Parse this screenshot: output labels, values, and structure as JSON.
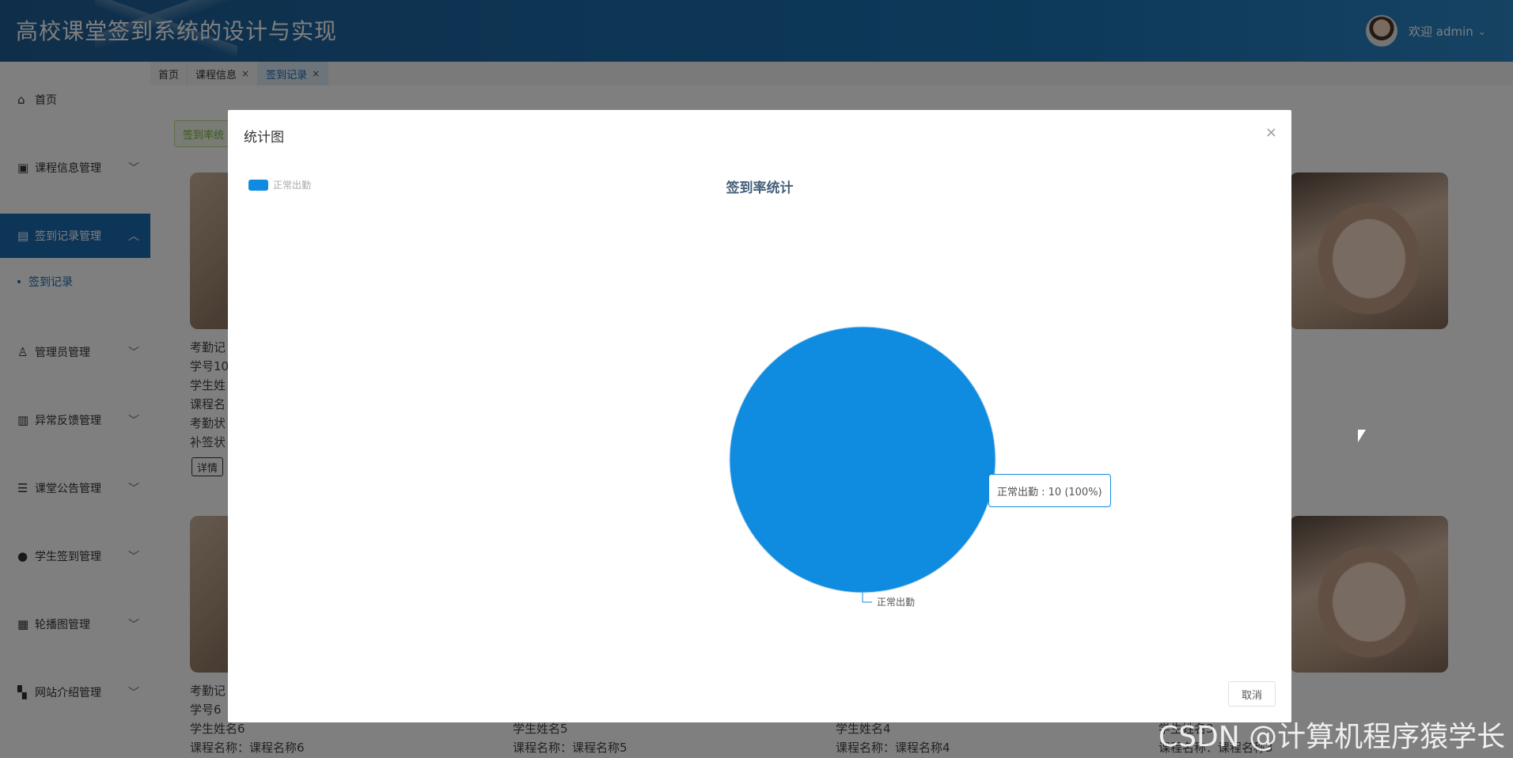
{
  "header": {
    "title": "高校课堂签到系统的设计与实现",
    "welcome": "欢迎 admin"
  },
  "sidebar": {
    "items": [
      {
        "label": "首页",
        "icon": "home-icon"
      },
      {
        "label": "课程信息管理",
        "icon": "book-icon"
      },
      {
        "label": "签到记录管理",
        "icon": "table-icon"
      },
      {
        "label": "管理员管理",
        "icon": "user-icon"
      },
      {
        "label": "异常反馈管理",
        "icon": "columns-icon"
      },
      {
        "label": "课堂公告管理",
        "icon": "storage-icon"
      },
      {
        "label": "学生签到管理",
        "icon": "chat-icon"
      },
      {
        "label": "轮播图管理",
        "icon": "layout-icon"
      },
      {
        "label": "网站介绍管理",
        "icon": "apps-icon"
      }
    ],
    "active_sub": "签到记录"
  },
  "tabs": [
    "首页",
    "课程信息",
    "签到记录"
  ],
  "main": {
    "stat_button": "签到率统",
    "card1_lines": [
      "考勤记",
      "学号10",
      "学生姓",
      "课程名",
      "考勤状",
      "补签状"
    ],
    "detail_label": "详情",
    "card2_prefix": "考勤记",
    "bottom_rows": [
      {
        "id": "学号6",
        "name": "学生姓名6",
        "course": "课程名称：课程名称6"
      },
      {
        "id": "",
        "name": "学生姓名5",
        "course": "课程名称：课程名称5"
      },
      {
        "id": "",
        "name": "学生姓名4",
        "course": "课程名称：课程名称4"
      },
      {
        "id": "",
        "name": "学生姓名3",
        "course": "课程名称：课程名称3"
      }
    ]
  },
  "modal": {
    "title": "统计图",
    "cancel": "取消"
  },
  "chart_data": {
    "type": "pie",
    "title": "签到率统计",
    "legend": [
      "正常出勤"
    ],
    "legend_position": "top-left",
    "slices": [
      {
        "name": "正常出勤",
        "value": 10,
        "percent": 100,
        "color": "#0f8be0"
      }
    ],
    "tooltip": "正常出勤 : 10 (100%)",
    "slice_label": "正常出勤"
  },
  "watermark": "CSDN @计算机程序猿学长"
}
